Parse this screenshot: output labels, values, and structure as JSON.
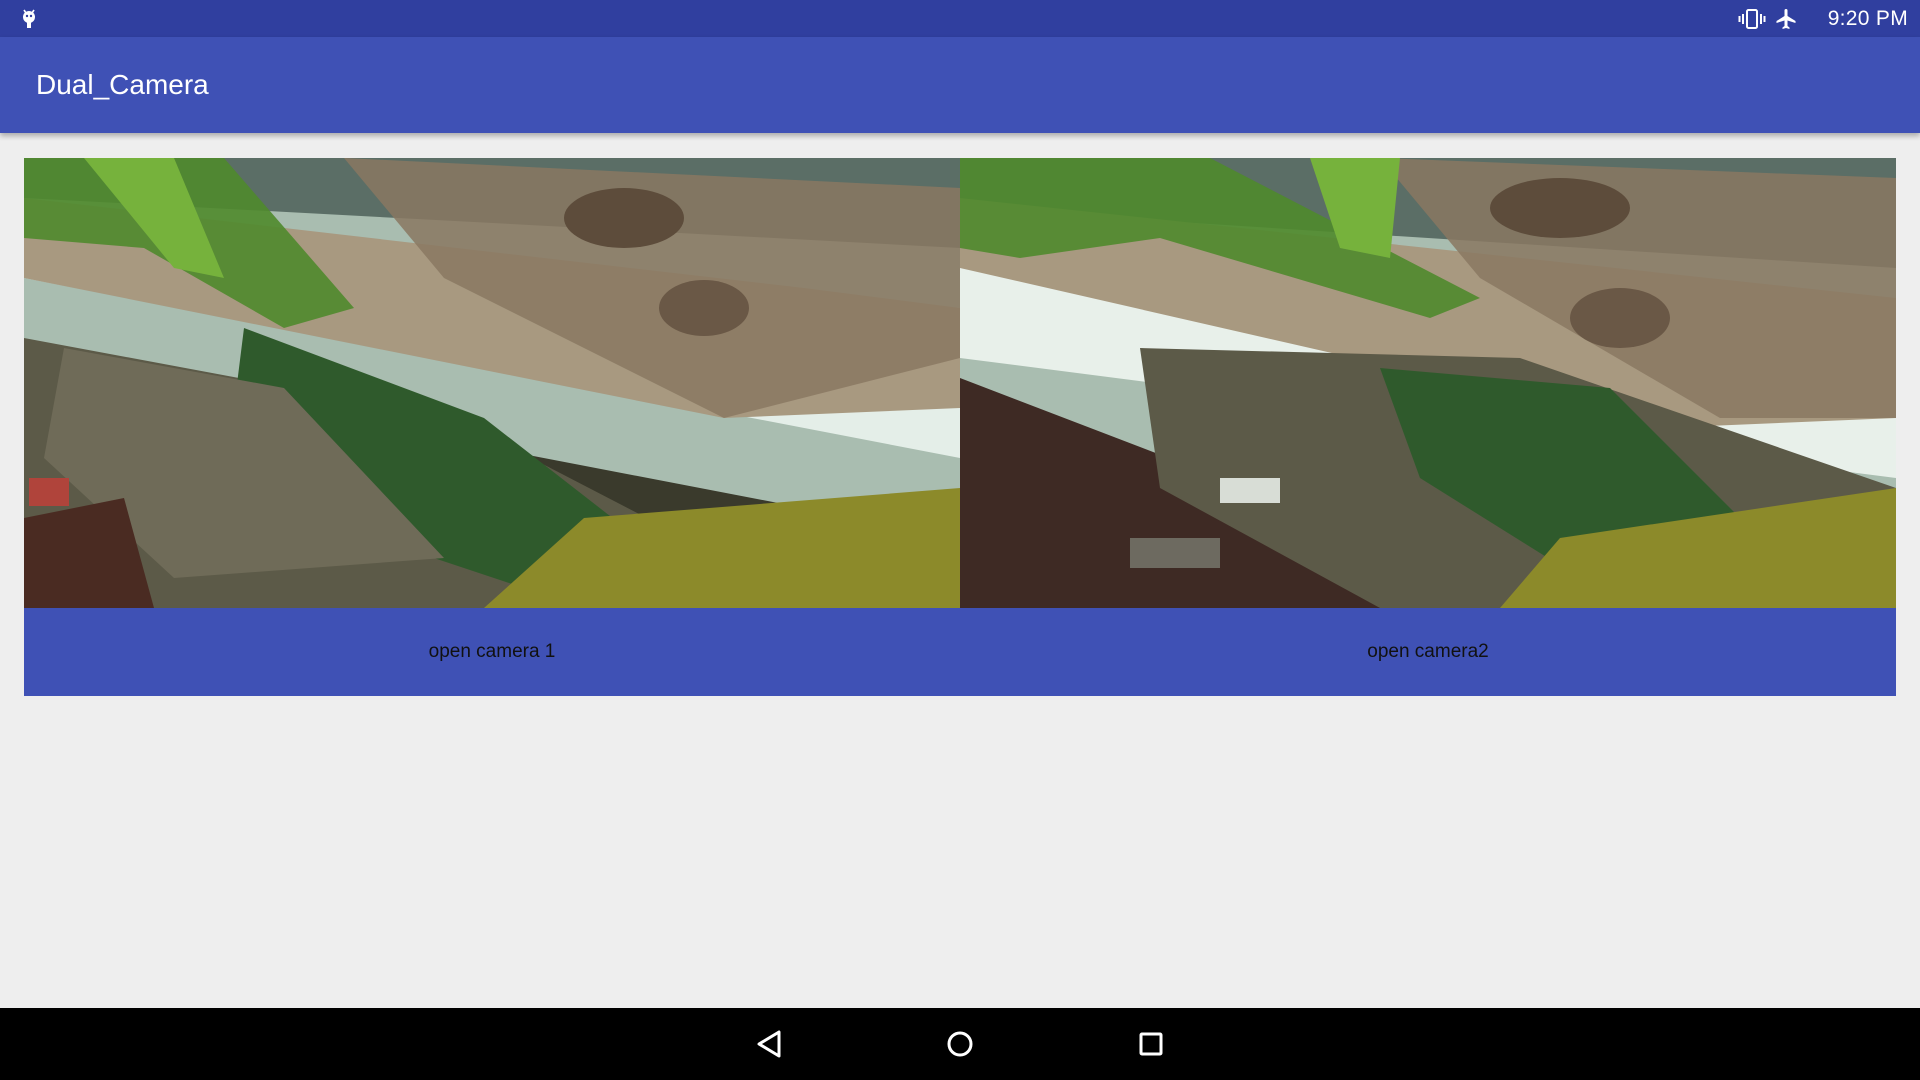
{
  "status_bar": {
    "time": "9:20 PM",
    "left_icon": "android-debug-icon",
    "right_icons": [
      "vibrate-icon",
      "airplane-mode-icon"
    ]
  },
  "app_bar": {
    "title": "Dual_Camera"
  },
  "camera_previews": [
    {
      "name": "camera-1-preview",
      "description_icon": "camera-preview-image"
    },
    {
      "name": "camera-2-preview",
      "description_icon": "camera-preview-image"
    }
  ],
  "buttons": {
    "open_camera_1": "open camera 1",
    "open_camera_2": "open camera2"
  },
  "nav_bar": {
    "items": [
      "back-icon",
      "home-icon",
      "recents-icon"
    ]
  },
  "colors": {
    "status_bar": "#303f9f",
    "app_bar": "#3f51b5",
    "button_bar": "#3f51b5",
    "background": "#eeeeee",
    "nav_bar": "#000000"
  }
}
